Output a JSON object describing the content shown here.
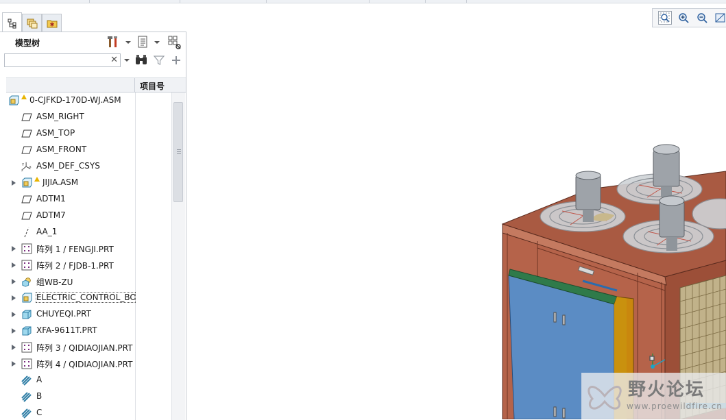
{
  "panel": {
    "title": "模型树",
    "search_value": "",
    "column_header": "项目号",
    "tabs": [
      "model-tree-tab",
      "layers-tab",
      "favorites-tab"
    ]
  },
  "tree": {
    "items": [
      {
        "label": "0-CJFKD-170D-WJ.ASM",
        "icon": "assembly-icon",
        "warn": true,
        "expand": false,
        "indent": 0
      },
      {
        "label": "ASM_RIGHT",
        "icon": "datum-plane-icon",
        "warn": false,
        "expand": false,
        "indent": 1
      },
      {
        "label": "ASM_TOP",
        "icon": "datum-plane-icon",
        "warn": false,
        "expand": false,
        "indent": 1
      },
      {
        "label": "ASM_FRONT",
        "icon": "datum-plane-icon",
        "warn": false,
        "expand": false,
        "indent": 1
      },
      {
        "label": "ASM_DEF_CSYS",
        "icon": "csys-icon",
        "warn": false,
        "expand": false,
        "indent": 1
      },
      {
        "label": "JIJIA.ASM",
        "icon": "assembly-icon",
        "warn": true,
        "expand": true,
        "indent": 1
      },
      {
        "label": "ADTM1",
        "icon": "datum-plane-icon",
        "warn": false,
        "expand": false,
        "indent": 1
      },
      {
        "label": "ADTM7",
        "icon": "datum-plane-icon",
        "warn": false,
        "expand": false,
        "indent": 1
      },
      {
        "label": "AA_1",
        "icon": "datum-axis-icon",
        "warn": false,
        "expand": false,
        "indent": 1
      },
      {
        "label": "阵列 1 / FENGJI.PRT",
        "icon": "pattern-icon",
        "warn": false,
        "expand": true,
        "indent": 1
      },
      {
        "label": "阵列 2 / FJDB-1.PRT",
        "icon": "pattern-icon",
        "warn": false,
        "expand": true,
        "indent": 1
      },
      {
        "label": "组WB-ZU",
        "icon": "group-icon",
        "warn": false,
        "expand": true,
        "indent": 1
      },
      {
        "label": "ELECTRIC_CONTROL_BOX",
        "icon": "assembly-icon",
        "warn": false,
        "expand": true,
        "indent": 1,
        "selected": true
      },
      {
        "label": "CHUYEQI.PRT",
        "icon": "part-icon",
        "warn": false,
        "expand": true,
        "indent": 1
      },
      {
        "label": "XFA-9611T.PRT",
        "icon": "part-icon",
        "warn": false,
        "expand": true,
        "indent": 1
      },
      {
        "label": "阵列 3 / QIDIAOJIAN.PRT",
        "icon": "pattern-icon",
        "warn": false,
        "expand": true,
        "indent": 1
      },
      {
        "label": "阵列 4 / QIDIAOJIAN.PRT",
        "icon": "pattern-icon",
        "warn": false,
        "expand": true,
        "indent": 1
      },
      {
        "label": "A",
        "icon": "cosmetic-icon",
        "warn": false,
        "expand": false,
        "indent": 1
      },
      {
        "label": "B",
        "icon": "cosmetic-icon",
        "warn": false,
        "expand": false,
        "indent": 1
      },
      {
        "label": "C",
        "icon": "cosmetic-icon",
        "warn": false,
        "expand": false,
        "indent": 1
      }
    ]
  },
  "view_toolbar": {
    "buttons": [
      "refit-icon",
      "zoom-in-icon",
      "zoom-out-icon",
      "view-icon"
    ]
  },
  "watermark": {
    "title": "野火论坛",
    "url": "www.proewildfire.cn"
  },
  "colors": {
    "cabinet": "#b5634a",
    "door": "#5b8cc4",
    "door_edge": "#2f7a4a",
    "fan_housing": "#a8adb3"
  }
}
